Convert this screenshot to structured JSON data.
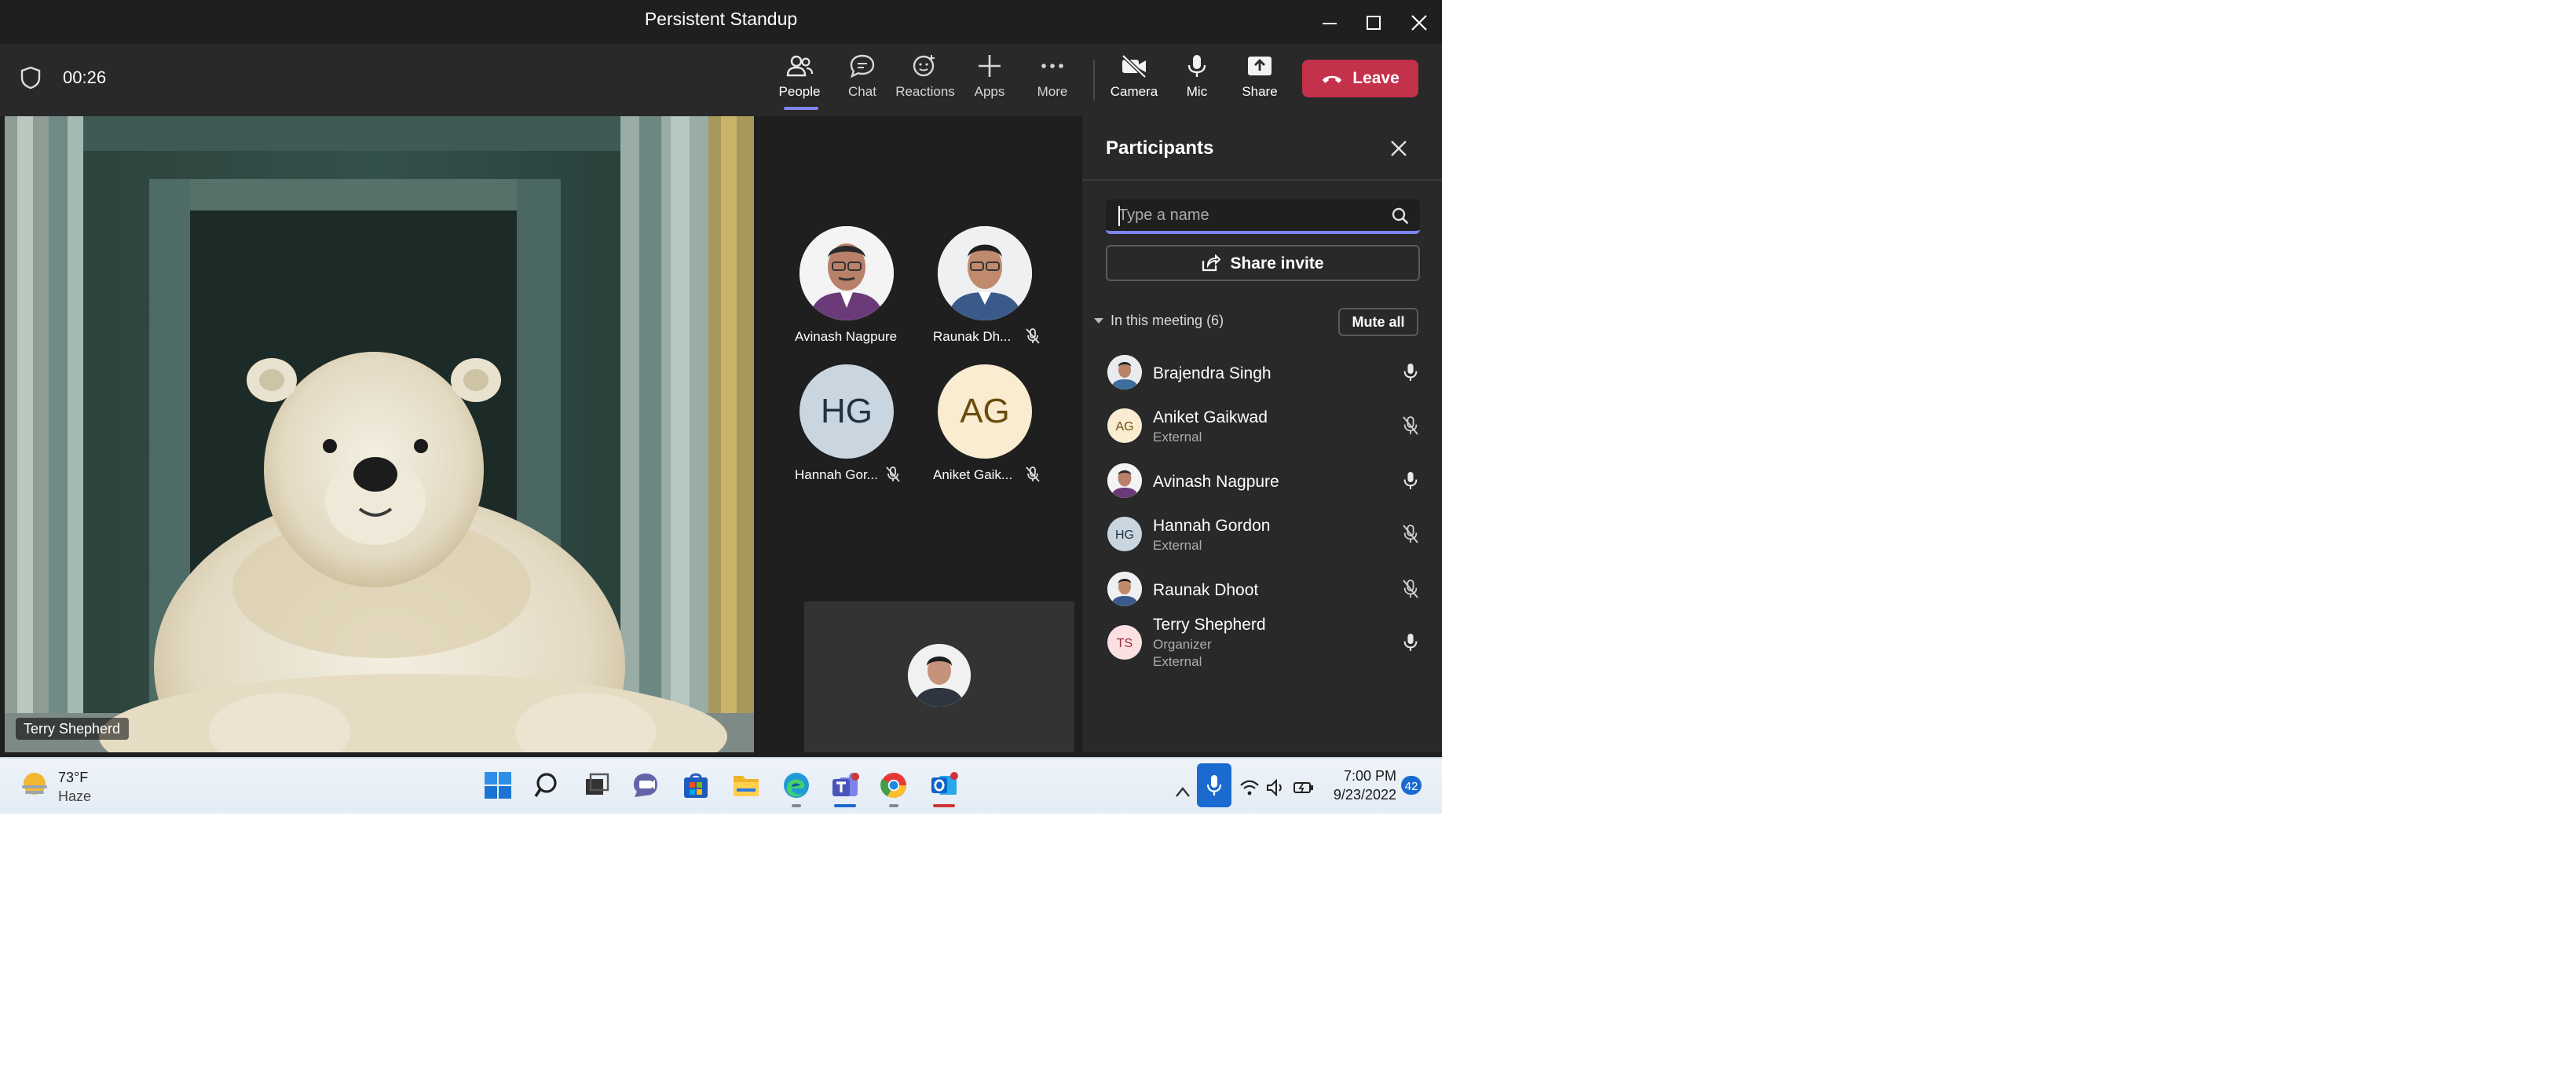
{
  "window": {
    "title": "Persistent Standup",
    "controls": [
      "minimize-icon",
      "maximize-icon",
      "close-icon"
    ]
  },
  "toolbar": {
    "timer": "00:26",
    "items": [
      {
        "label": "People",
        "icon": "people-icon",
        "active": true
      },
      {
        "label": "Chat",
        "icon": "chat-icon"
      },
      {
        "label": "Reactions",
        "icon": "reactions-icon"
      },
      {
        "label": "Apps",
        "icon": "plus-icon"
      },
      {
        "label": "More",
        "icon": "more-icon"
      },
      {
        "label": "Camera",
        "icon": "camera-off-icon"
      },
      {
        "label": "Mic",
        "icon": "mic-icon"
      },
      {
        "label": "Share",
        "icon": "share-tray-icon"
      }
    ],
    "leave_label": "Leave",
    "leave_color": "#c4314b",
    "accent_color": "#7f85f5"
  },
  "stage": {
    "main_video_name": "Terry Shepherd",
    "tiles": [
      {
        "name": "Avinash Nagpure",
        "type": "photo",
        "muted": false
      },
      {
        "name": "Raunak Dh...",
        "type": "photo",
        "muted": true
      },
      {
        "name": "Hannah Gor...",
        "type": "initials",
        "initials": "HG",
        "color": "#c9d5df",
        "text_color": "#1f3240",
        "muted": true
      },
      {
        "name": "Aniket Gaik...",
        "type": "initials",
        "initials": "AG",
        "color": "#f9ecd0",
        "text_color": "#6b4c0c",
        "muted": true
      }
    ]
  },
  "participants": {
    "title": "Participants",
    "search_placeholder": "Type a name",
    "share_invite_label": "Share invite",
    "section_label": "In this meeting (6)",
    "mute_all_label": "Mute all",
    "list": [
      {
        "name": "Brajendra Singh",
        "sub1": "",
        "sub2": "",
        "avatar": "photo",
        "mic": "on"
      },
      {
        "name": "Aniket Gaikwad",
        "sub1": "External",
        "sub2": "",
        "avatar": "AG",
        "avatar_color": "#f9ecd0",
        "avatar_text": "#6b4c0c",
        "mic": "muted"
      },
      {
        "name": "Avinash Nagpure",
        "sub1": "",
        "sub2": "",
        "avatar": "photo",
        "mic": "on"
      },
      {
        "name": "Hannah Gordon",
        "sub1": "External",
        "sub2": "",
        "avatar": "HG",
        "avatar_color": "#c9d5df",
        "avatar_text": "#1f3240",
        "mic": "muted"
      },
      {
        "name": "Raunak Dhoot",
        "sub1": "",
        "sub2": "",
        "avatar": "photo",
        "mic": "muted"
      },
      {
        "name": "Terry Shepherd",
        "sub1": "Organizer",
        "sub2": "External",
        "avatar": "TS",
        "avatar_color": "#fbe0e2",
        "avatar_text": "#9a2a36",
        "mic": "on"
      }
    ]
  },
  "taskbar": {
    "weather_temp": "73°F",
    "weather_desc": "Haze",
    "apps": [
      "start-icon",
      "search-icon",
      "task-view-icon",
      "teams-chat-icon",
      "store-icon",
      "file-explorer-icon",
      "edge-icon",
      "teams-icon",
      "chrome-icon",
      "outlook-icon"
    ],
    "time": "7:00 PM",
    "date": "9/23/2022",
    "notification_count": "42"
  }
}
